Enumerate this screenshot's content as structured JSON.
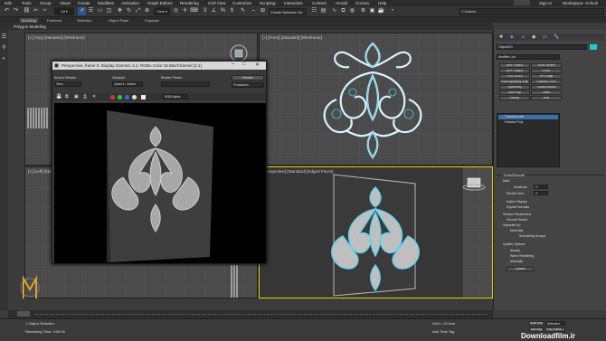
{
  "menu": [
    "Edit",
    "Tools",
    "Group",
    "Views",
    "Create",
    "Modifiers",
    "Animation",
    "Graph Editors",
    "Rendering",
    "Civil View",
    "Customize",
    "Scripting",
    "Interactive",
    "Content",
    "Arnold",
    "Corona",
    "Help"
  ],
  "top_right": {
    "sign_in": "Sign In",
    "workspace": "Default",
    "path": "C:\\Users\\..."
  },
  "toolbar": {
    "selection_set": "Create Selection Se"
  },
  "ribbon": {
    "tabs": [
      "Modeling",
      "Freeform",
      "Selection",
      "Object Paint",
      "Populate"
    ],
    "active": "Modeling",
    "sub": "Polygon Modeling"
  },
  "viewports": {
    "top": "[+] [Top] [Standard] [Wireframe]",
    "front": "[+] [Front] [Standard] [Wireframe]",
    "left": "[+] [Left] [Standard] [Wireframe]",
    "perspective": "[Perspective] [Standard] [Edged Faces]"
  },
  "render_dialog": {
    "title": "Perspective, frame 0, Display Gamma: 2.2, RGBA Color 16 Bits/Channel (1:1)",
    "area_label": "Area to Render:",
    "area_value": "View",
    "viewport_label": "Viewport:",
    "viewport_value": "Quad 4 - Active",
    "preset_label": "Render Preset:",
    "preset_value": "",
    "render_button": "Render",
    "production": "Production",
    "channel": "RGB Alpha"
  },
  "command_panel": {
    "object_name": "Object001",
    "modifier_list": "Modifier List",
    "buttons": [
      "MPP Select",
      "UVW Select",
      "MPP Select",
      "Push",
      "FFD 2x2x2",
      "FFD Map",
      "Push Applying Map",
      "Unwrap UVW",
      "Symmetry",
      "TurboSmooth",
      "Edit Poly",
      "Shell",
      "Sweep",
      "Edit"
    ],
    "stack": [
      "TurboSmooth",
      "Editable Poly"
    ],
    "rollout_title": "TurboSmooth",
    "main_label": "Main",
    "iterations_label": "Iterations:",
    "iterations": "2",
    "render_iters_label": "Render Iters:",
    "render_iters": "0",
    "isoline": "Isoline Display",
    "explicit": "Explicit Normals",
    "surface_params": "Surface Parameters",
    "smooth_result": "Smooth Result",
    "separate_by": "Separate by:",
    "materials": "Materials",
    "smoothing_groups": "Smoothing Groups",
    "update_options": "Update Options",
    "always": "Always",
    "when_rendering": "When Rendering",
    "manually": "Manually",
    "update_btn": "Update"
  },
  "status": {
    "selected": "1 Object Selected",
    "render_time": "Rendering Time: 0:00:06",
    "grid": "Grid = 10.0cm",
    "add_time_tag": "Add Time Tag",
    "auto_key": "Auto Key",
    "set_key": "Set Key",
    "selected_dd": "Selected",
    "key_filters": "Key Filters..."
  },
  "watermark": "Downloadfilm.ir"
}
